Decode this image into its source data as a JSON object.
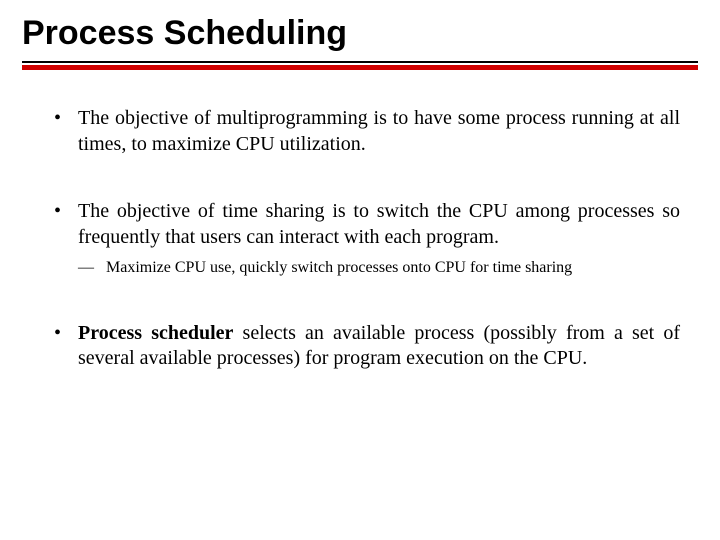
{
  "title": "Process Scheduling",
  "bullets": {
    "b1": "The objective of multiprogramming is to have some process running at all times, to maximize CPU utilization.",
    "b2": "The objective of time sharing is to switch the CPU among processes so frequently that users can interact with each program.",
    "b2_sub1": "Maximize CPU use, quickly switch processes onto CPU for time sharing",
    "b3_bold": "Process scheduler",
    "b3_rest": " selects an available process (possibly from a set of several available processes) for program execution on the CPU."
  }
}
